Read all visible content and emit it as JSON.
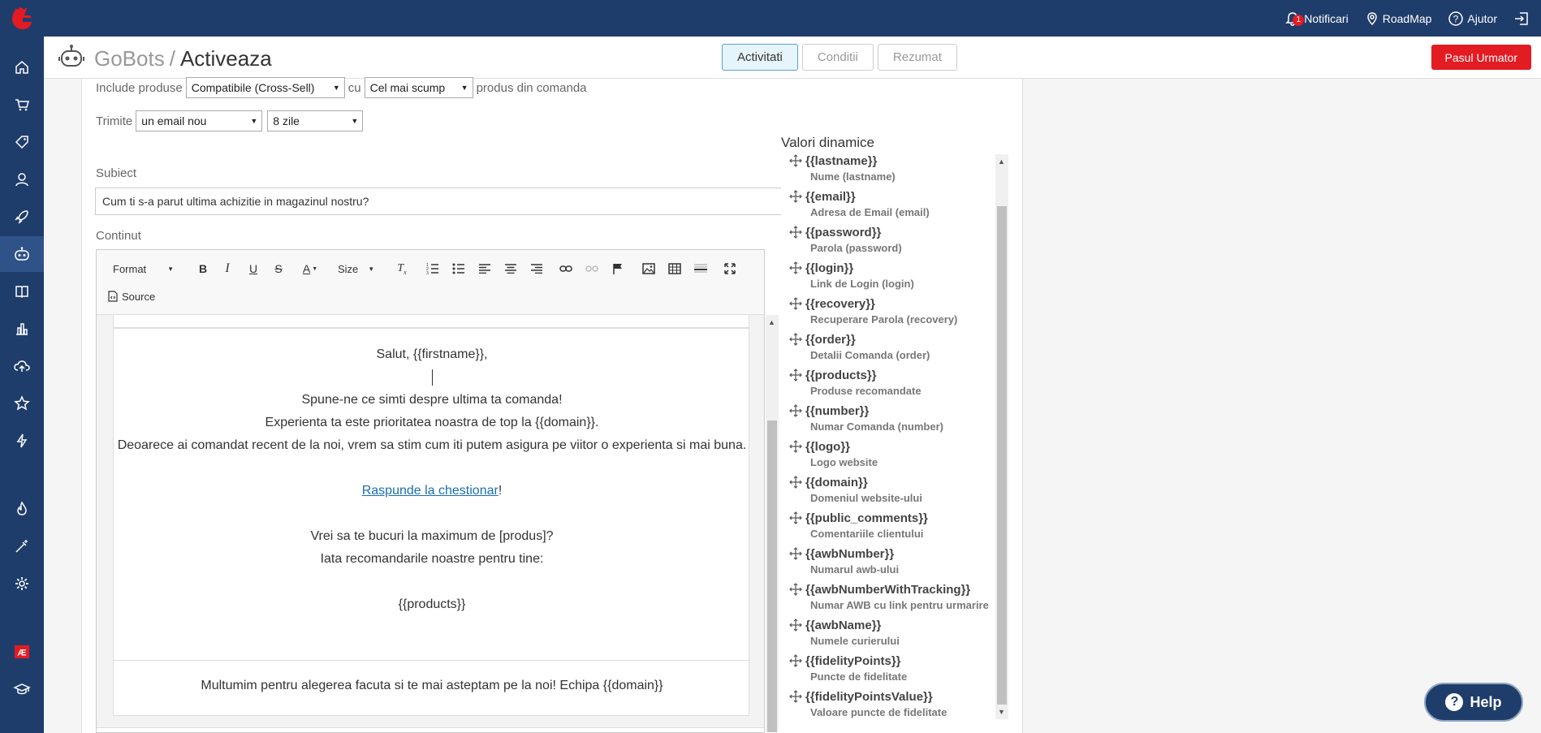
{
  "topbar": {
    "notifications_label": "Notificari",
    "notifications_count": "1",
    "roadmap_label": "RoadMap",
    "help_label": "Ajutor"
  },
  "header": {
    "app_name": "GoBots",
    "separator": "/",
    "current_page": "Activeaza",
    "tabs": [
      "Activitati",
      "Conditii",
      "Rezumat"
    ],
    "next_button": "Pasul Urmator"
  },
  "form": {
    "include_label": "Include produse",
    "include_select": "Compatibile (Cross-Sell)",
    "with_label": "cu",
    "price_select": "Cel mai scump",
    "product_suffix": "produs din comanda",
    "send_label": "Trimite",
    "email_select": "un email nou",
    "days_select": "8 zile",
    "subject_label": "Subiect",
    "subject_value": "Cum ti s-a parut ultima achizitie in magazinul nostru?",
    "content_label": "Continut"
  },
  "editor": {
    "format_label": "Format",
    "size_label": "Size",
    "source_label": "Source",
    "greeting": "Salut, {{firstname}},",
    "line1": "Spune-ne ce simti despre ultima ta comanda!",
    "line2": "Experienta ta este prioritatea noastra de top la {{domain}}.",
    "line3": "Deoarece ai comandat recent de la noi, vrem sa stim cum iti putem asigura pe viitor o experienta si mai buna.",
    "link_text": "Raspunde la chestionar",
    "link_suffix": "!",
    "line4": "Vrei sa te bucuri la maximum de [produs]?",
    "line5": "Iata recomandarile noastre pentru tine:",
    "products": "{{products}}",
    "footer": "Multumim pentru alegerea facuta si te mai asteptam pe la noi! Echipa {{domain}}"
  },
  "dynamic": {
    "title": "Valori dinamice",
    "items": [
      {
        "tag": "{{lastname}}",
        "desc": "Nume (lastname)"
      },
      {
        "tag": "{{email}}",
        "desc": "Adresa de Email (email)"
      },
      {
        "tag": "{{password}}",
        "desc": "Parola (password)"
      },
      {
        "tag": "{{login}}",
        "desc": "Link de Login (login)"
      },
      {
        "tag": "{{recovery}}",
        "desc": "Recuperare Parola (recovery)"
      },
      {
        "tag": "{{order}}",
        "desc": "Detalii Comanda (order)"
      },
      {
        "tag": "{{products}}",
        "desc": "Produse recomandate"
      },
      {
        "tag": "{{number}}",
        "desc": "Numar Comanda (number)"
      },
      {
        "tag": "{{logo}}",
        "desc": "Logo website"
      },
      {
        "tag": "{{domain}}",
        "desc": "Domeniul website-ului"
      },
      {
        "tag": "{{public_comments}}",
        "desc": "Comentariile clientului"
      },
      {
        "tag": "{{awbNumber}}",
        "desc": "Numarul awb-ului"
      },
      {
        "tag": "{{awbNumberWithTracking}}",
        "desc": "Numar AWB cu link pentru urmarire"
      },
      {
        "tag": "{{awbName}}",
        "desc": "Numele curierului"
      },
      {
        "tag": "{{fidelityPoints}}",
        "desc": "Puncte de fidelitate"
      },
      {
        "tag": "{{fidelityPointsValue}}",
        "desc": "Valoare puncte de fidelitate"
      }
    ]
  },
  "help_button": "Help",
  "colors": {
    "nav_bg": "#1f3d6b",
    "accent_red": "#e31b23",
    "active_tab_bg": "#e6f4fb",
    "link": "#1a6fb3"
  }
}
